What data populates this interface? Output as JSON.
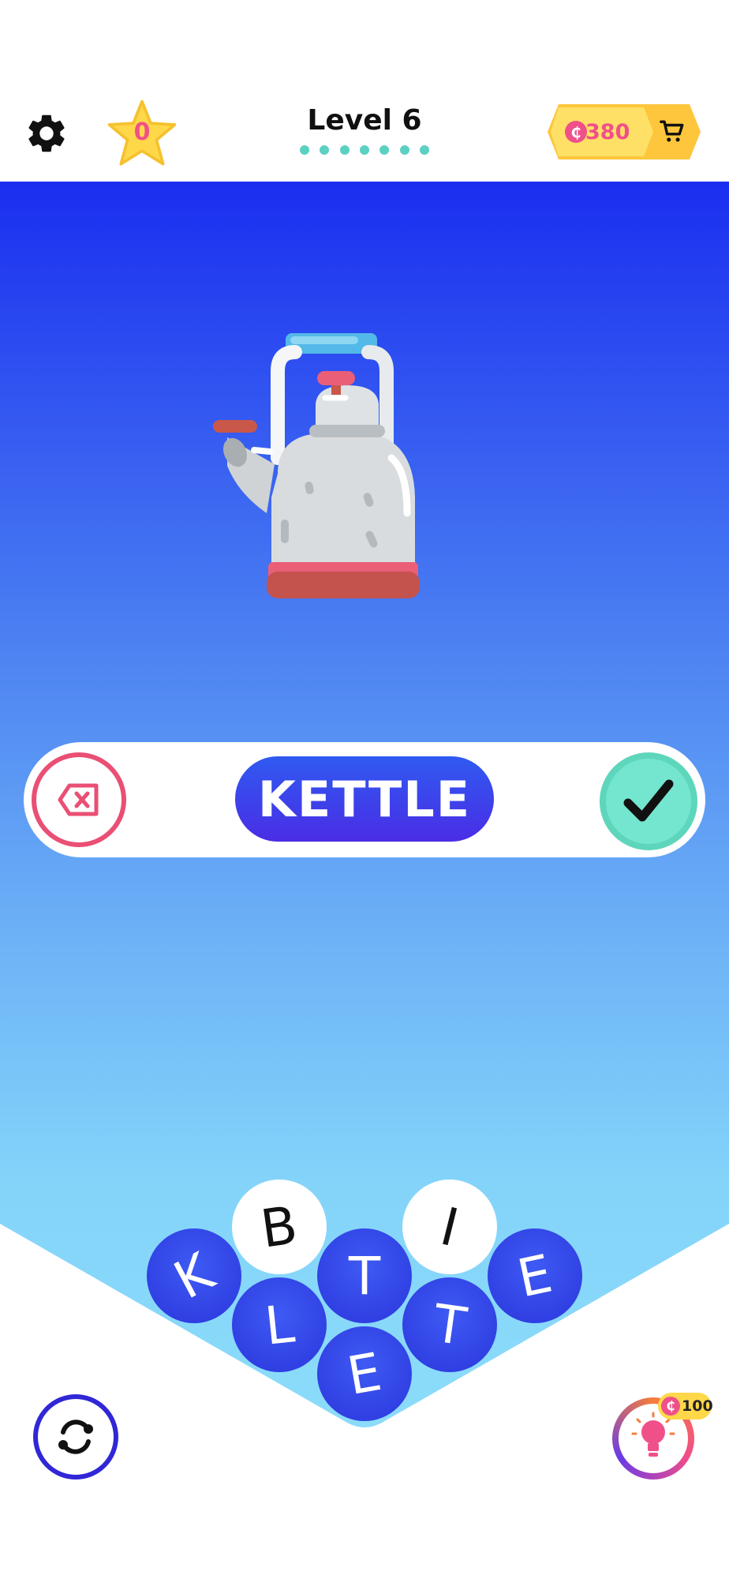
{
  "header": {
    "stars": "0",
    "level_title": "Level 6",
    "progress_dots": 7,
    "coins": "380",
    "coin_symbol": "₵"
  },
  "answer": {
    "word": "KETTLE"
  },
  "tiles": [
    {
      "letter": "K",
      "style": "blue"
    },
    {
      "letter": "B",
      "style": "white"
    },
    {
      "letter": "T",
      "style": "blue"
    },
    {
      "letter": "I",
      "style": "white"
    },
    {
      "letter": "E",
      "style": "blue"
    },
    {
      "letter": "L",
      "style": "blue"
    },
    {
      "letter": "T",
      "style": "blue"
    },
    {
      "letter": "E",
      "style": "blue"
    }
  ],
  "hint": {
    "cost": "100",
    "coin_symbol": "₵"
  },
  "colors": {
    "accent_pink": "#f0508a",
    "tile_blue": "#2b36dc",
    "confirm_green": "#74e6cf",
    "delete_red": "#ea4f74"
  }
}
